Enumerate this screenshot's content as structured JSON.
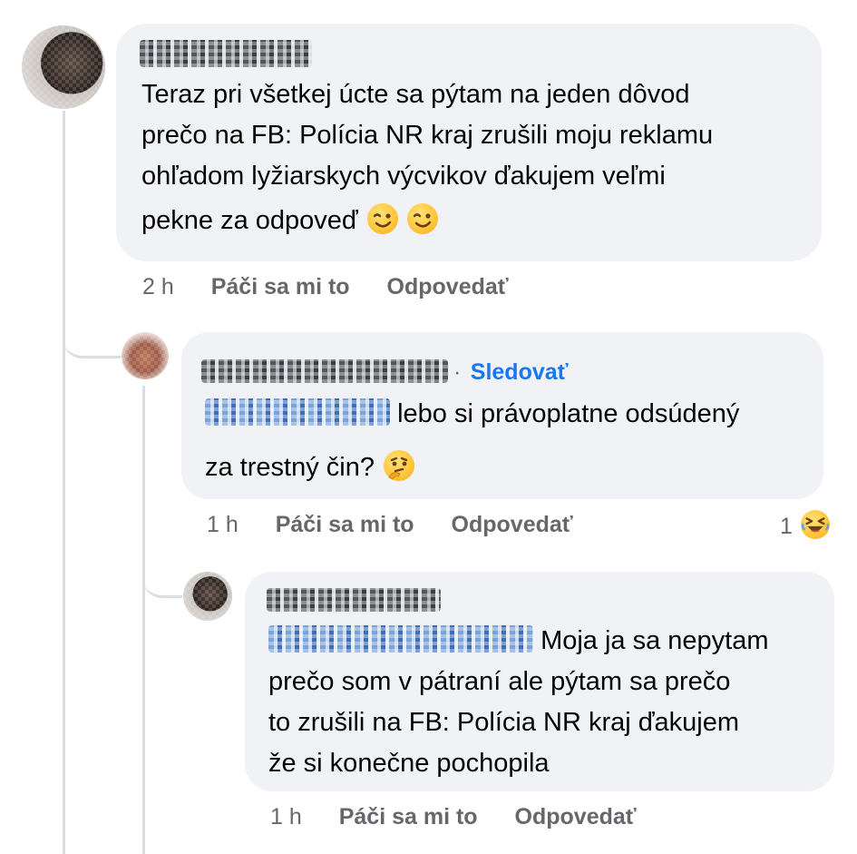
{
  "comments": [
    {
      "author_blurred": "Lukáš Kramák",
      "text": "Teraz pri všetkej úcte sa pýtam na jeden dôvod prečo na FB: Polícia NR kraj zrušili moju reklamu ohľadom lyžiarskych výcvikov ďakujem veľmi pekne za odpoveď",
      "line1": "Teraz pri všetkej úcte sa pýtam na jeden dôvod",
      "line2": "prečo na FB: Polícia NR kraj zrušili moju reklamu",
      "line3": "ohľadom lyžiarskych výcvikov ďakujem veľmi",
      "line4": "pekne za odpoveď",
      "emoji": [
        "winking-face",
        "winking-face"
      ],
      "time": "2 h",
      "like": "Páči sa mi to",
      "reply": "Odpovedať"
    },
    {
      "author_blurred": "Romana Turancová",
      "follow": "Sledovať",
      "follow_separator": "·",
      "mention_blurred": "Lukáš Kramák",
      "line1": "lebo si právoplatne odsúdený",
      "line2": "za trestný čin?",
      "emoji": [
        "thinking-face"
      ],
      "time": "1 h",
      "like": "Páči sa mi to",
      "reply": "Odpovedať",
      "reaction_count": "1",
      "reaction": "laughing-face"
    },
    {
      "author_blurred": "Lukáš Kramák",
      "mention_blurred": "Romana Turancová",
      "line1": "Moja ja sa nepytam",
      "line2": "prečo som v pátraní ale pýtam sa prečo",
      "line3": "to zrušili na FB: Polícia NR kraj ďakujem",
      "line4": "že si konečne pochopila",
      "time": "1 h",
      "like": "Páči sa mi to",
      "reply": "Odpovedať"
    }
  ],
  "colors": {
    "bubble": "#f0f2f5",
    "meta": "#65676b",
    "link": "#1877f2",
    "thread": "#dadde1"
  }
}
